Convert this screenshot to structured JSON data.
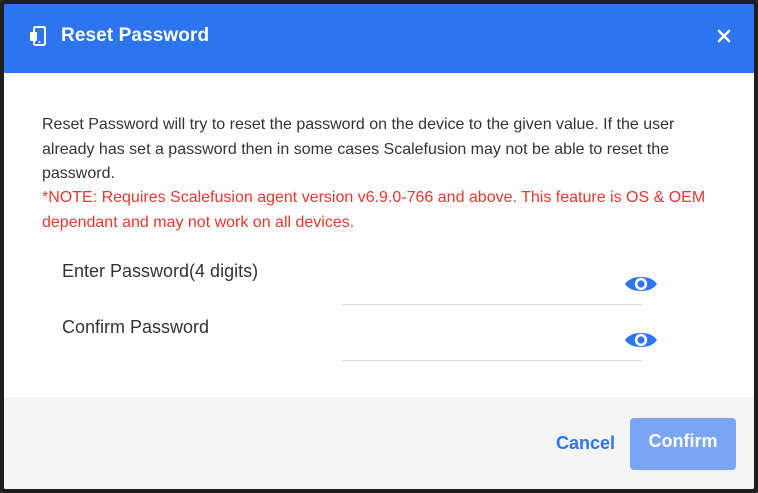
{
  "dialog": {
    "title": "Reset Password",
    "description": "Reset Password will try to reset the password on the device to the given value. If the user already has set a password then in some cases Scalefusion may not be able to reset the password.",
    "note": "*NOTE: Requires Scalefusion agent version v6.9.0-766 and above. This feature is OS & OEM dependant and may not work on all devices."
  },
  "fields": {
    "enter_label": "Enter Password(4 digits)",
    "enter_value": "",
    "confirm_label": "Confirm Password",
    "confirm_value": ""
  },
  "footer": {
    "cancel_label": "Cancel",
    "confirm_label": "Confirm"
  },
  "icons": {
    "header": "device-key-icon",
    "close": "close-icon",
    "toggle": "eye-icon"
  },
  "colors": {
    "accent": "#2c74f0",
    "note": "#e8382f",
    "confirm_disabled": "#7aa4f4"
  }
}
